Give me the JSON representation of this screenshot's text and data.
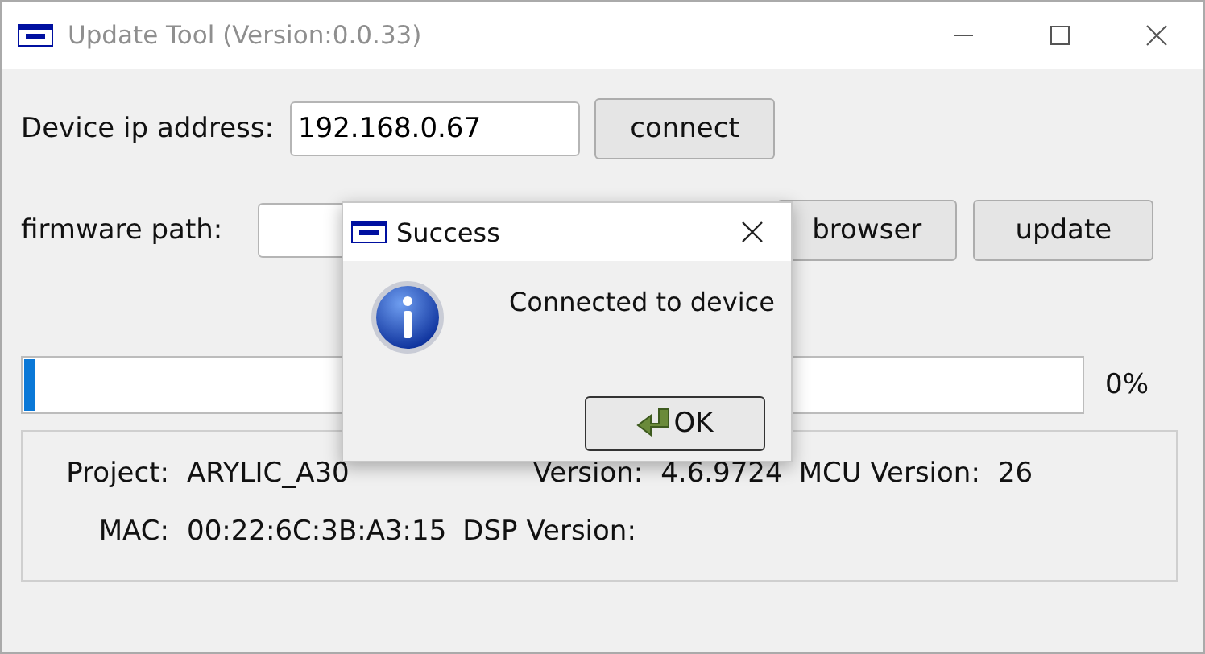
{
  "window": {
    "title": "Update Tool (Version:0.0.33)"
  },
  "device_ip": {
    "label": "Device ip address:",
    "value": "192.168.0.67",
    "button": "connect"
  },
  "firmware": {
    "label": "firmware path:",
    "buttons": [
      "browser",
      "update"
    ]
  },
  "progress": {
    "level": 0.01,
    "reading": "0%"
  },
  "info": {
    "rows": [
      [
        {
          "label": "Project:",
          "value": "ARYLIC_A30"
        },
        {
          "label": "Version:",
          "value": "4.6.9724"
        },
        {
          "label": "MCU Version:",
          "value": "26"
        }
      ],
      [
        {
          "label": "MAC:",
          "value": "00:22:6C:3B:A3:15"
        },
        {
          "label": "DSP Version:"
        }
      ]
    ]
  },
  "dialog": {
    "title": "Success",
    "message": "Connected to device",
    "button": "OK"
  }
}
